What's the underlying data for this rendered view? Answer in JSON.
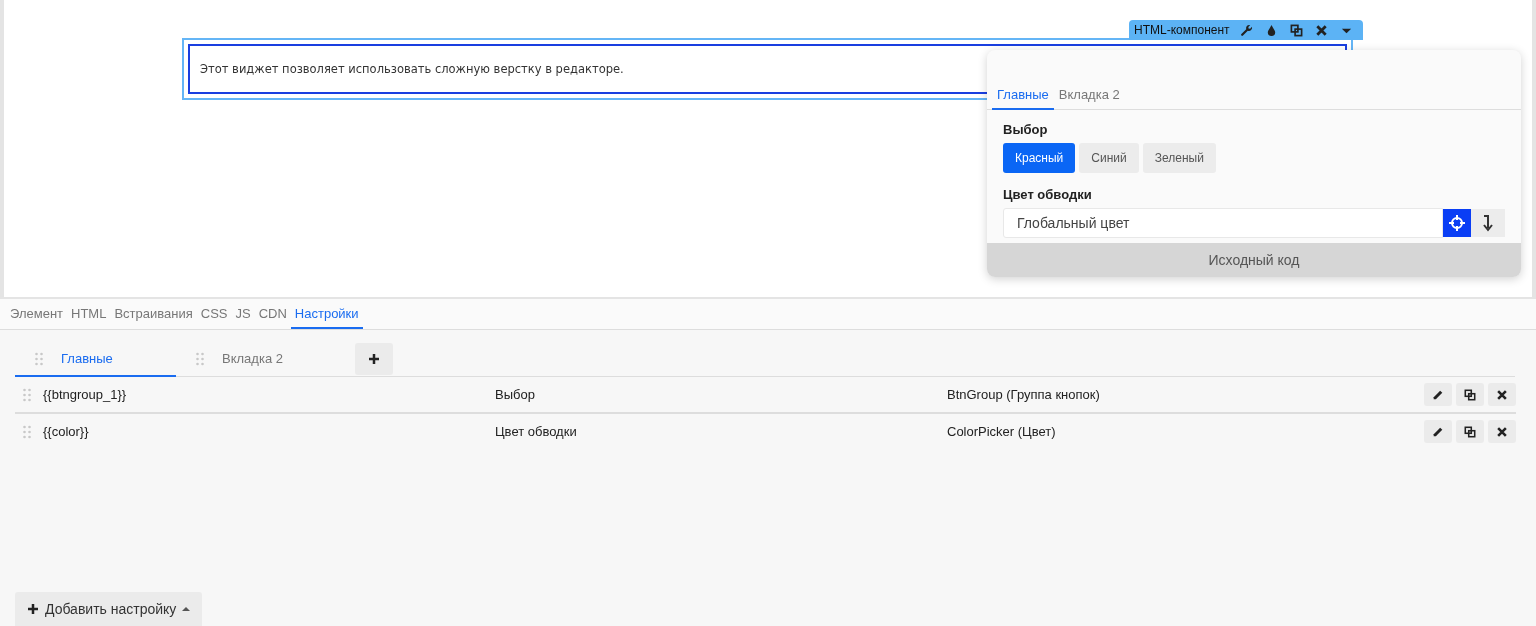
{
  "widget": {
    "label": "HTML-компонент",
    "text": "Этот виджет позволяет использовать сложную верстку в редакторе."
  },
  "popover": {
    "tabs": [
      {
        "label": "Главные",
        "selected": true
      },
      {
        "label": "Вкладка 2",
        "selected": false
      }
    ],
    "fields": [
      {
        "kind": "buttons",
        "label": "Выбор",
        "options": [
          {
            "label": "Красный",
            "selected": true
          },
          {
            "label": "Синий",
            "selected": false
          },
          {
            "label": "Зеленый",
            "selected": false
          }
        ]
      },
      {
        "kind": "color",
        "label": "Цвет обводки",
        "value": "Глобальный цвет"
      }
    ],
    "footer": "Исходный код"
  },
  "panel_tabs": [
    {
      "label": "Элемент",
      "selected": false
    },
    {
      "label": "HTML",
      "selected": false
    },
    {
      "label": "Встраивания",
      "selected": false
    },
    {
      "label": "CSS",
      "selected": false
    },
    {
      "label": "JS",
      "selected": false
    },
    {
      "label": "CDN",
      "selected": false
    },
    {
      "label": "Настройки",
      "selected": true
    }
  ],
  "settings_tabs": [
    {
      "label": "Главные",
      "selected": true
    },
    {
      "label": "Вкладка 2",
      "selected": false
    }
  ],
  "rows": [
    {
      "variable": "{{btngroup_1}}",
      "title": "Выбор",
      "type": "BtnGroup (Группа кнопок)"
    },
    {
      "variable": "{{color}}",
      "title": "Цвет обводки",
      "type": "ColorPicker (Цвет)"
    }
  ],
  "add_button": "Добавить настройку"
}
